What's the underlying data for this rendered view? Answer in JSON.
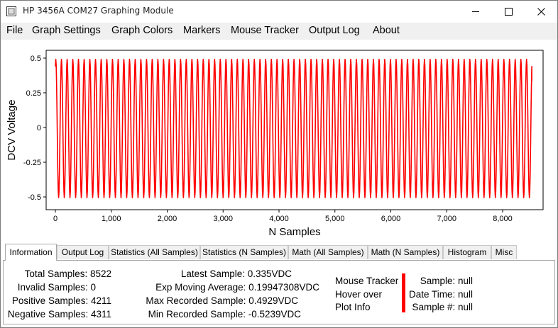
{
  "window": {
    "title": "HP 3456A COM27 Graphing Module",
    "controls": [
      "minimize",
      "maximize",
      "close"
    ]
  },
  "menu": [
    "File",
    "Graph Settings",
    "Graph Colors",
    "Markers",
    "Mouse Tracker",
    "Output Log",
    "About"
  ],
  "chart_data": {
    "type": "line",
    "xlabel": "N Samples",
    "ylabel": "DCV Voltage",
    "xlim": [
      0,
      8522
    ],
    "ylim": [
      -0.55,
      0.55
    ],
    "x_ticks": [
      0,
      1000,
      2000,
      3000,
      4000,
      5000,
      6000,
      7000,
      8000
    ],
    "x_tick_labels": [
      "0",
      "1,000",
      "2,000",
      "3,000",
      "4,000",
      "5,000",
      "6,000",
      "7,000",
      "8,000"
    ],
    "y_ticks": [
      0.5,
      0.25,
      0,
      -0.25,
      -0.5
    ],
    "y_tick_labels": [
      "0.5",
      "0.25",
      "0",
      "-0.25",
      "-0.5"
    ],
    "series": [
      {
        "color": "#ff0000",
        "waveform": "sine",
        "cycles": 84,
        "amplitude": 0.5,
        "offset": -0.005,
        "samples": 8522,
        "first": 0.44,
        "last": 0.335
      }
    ],
    "grid": false
  },
  "tabs": [
    {
      "label": "Information",
      "active": true
    },
    {
      "label": "Output Log",
      "active": false
    },
    {
      "label": "Statistics (All Samples)",
      "active": false
    },
    {
      "label": "Statistics (N Samples)",
      "active": false
    },
    {
      "label": "Math (All Samples)",
      "active": false
    },
    {
      "label": "Math (N Samples)",
      "active": false
    },
    {
      "label": "Histogram",
      "active": false
    },
    {
      "label": "Misc",
      "active": false
    }
  ],
  "info": {
    "col1": [
      "Total Samples: 8522",
      "Invalid Samples: 0",
      "Positive Samples: 4211",
      "Negative Samples: 4311"
    ],
    "col2": [
      "Latest Sample: 0.335VDC",
      "Exp Moving Average: 0.19947308VDC",
      "Max Recorded Sample: 0.4929VDC",
      "Min Recorded Sample: -0.5239VDC"
    ],
    "tracker_label": [
      "Mouse Tracker",
      "Hover over",
      "Plot Info"
    ],
    "tracker_color": "#ff0000",
    "tracker_values": [
      "Sample: null",
      "Date Time: null",
      "Sample #: null"
    ]
  }
}
